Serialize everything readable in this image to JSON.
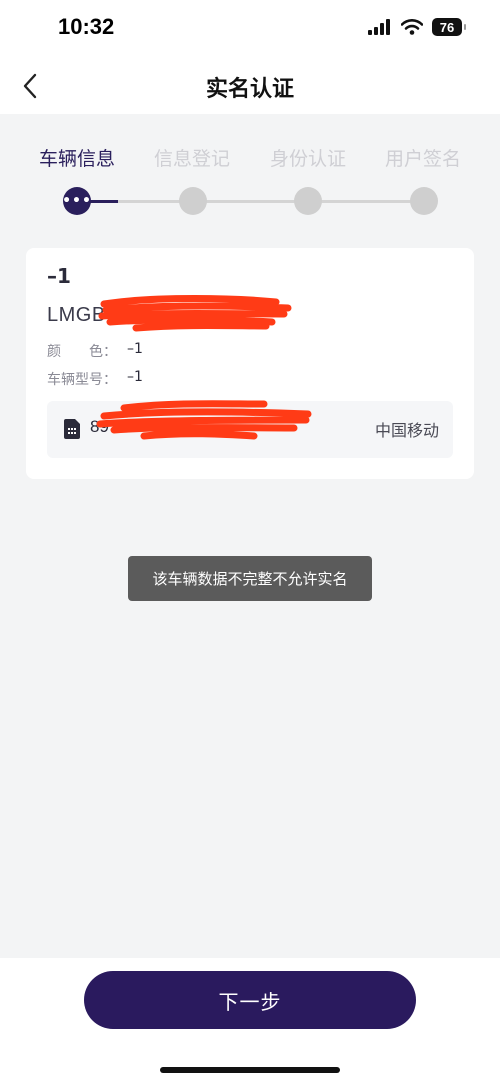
{
  "status_bar": {
    "time": "10:32",
    "battery": "76"
  },
  "nav": {
    "title": "实名认证"
  },
  "steps": [
    {
      "label": "车辆信息",
      "active": true
    },
    {
      "label": "信息登记",
      "active": false
    },
    {
      "label": "身份认证",
      "active": false
    },
    {
      "label": "用户签名",
      "active": false
    }
  ],
  "active_step_indicator": "•••",
  "vehicle": {
    "plate": "–1",
    "vin": "LMGB",
    "color_label": "颜　　色：",
    "color_value": "–1",
    "model_label": "车辆型号：",
    "model_value": "–1",
    "sim_prefix": "89",
    "carrier": "中国移动"
  },
  "toast": "该车辆数据不完整不允许实名",
  "footer": {
    "next_label": "下一步"
  },
  "colors": {
    "accent": "#2a1a5e",
    "redaction": "#ff3b16"
  }
}
